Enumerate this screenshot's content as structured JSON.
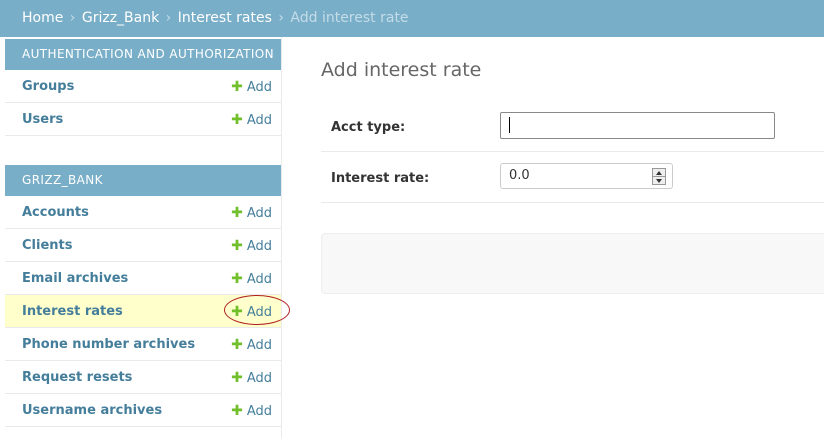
{
  "breadcrumbs": {
    "home": "Home",
    "app": "Grizz_Bank",
    "model": "Interest rates",
    "current": "Add interest rate",
    "separator": "›"
  },
  "sidebar": {
    "modules": [
      {
        "caption": "AUTHENTICATION AND AUTHORIZATION",
        "models": [
          {
            "label": "Groups",
            "add": "Add"
          },
          {
            "label": "Users",
            "add": "Add"
          }
        ]
      },
      {
        "caption": "GRIZZ_BANK",
        "models": [
          {
            "label": "Accounts",
            "add": "Add"
          },
          {
            "label": "Clients",
            "add": "Add"
          },
          {
            "label": "Email archives",
            "add": "Add"
          },
          {
            "label": "Interest rates",
            "add": "Add",
            "selected": true
          },
          {
            "label": "Phone number archives",
            "add": "Add"
          },
          {
            "label": "Request resets",
            "add": "Add"
          },
          {
            "label": "Username archives",
            "add": "Add"
          }
        ]
      }
    ]
  },
  "main": {
    "title": "Add interest rate",
    "fields": {
      "acct_type": {
        "label": "Acct type:",
        "value": ""
      },
      "interest_rate": {
        "label": "Interest rate:",
        "value": "0.0"
      }
    }
  },
  "colors": {
    "header": "#79aec8",
    "link": "#447e9b",
    "add_icon": "#70bf2b",
    "selected_row": "#ffffcc",
    "highlight_circle": "#b22222"
  },
  "icons": {
    "add": "plus-icon",
    "spinner_up": "arrow-up-icon",
    "spinner_down": "arrow-down-icon"
  }
}
